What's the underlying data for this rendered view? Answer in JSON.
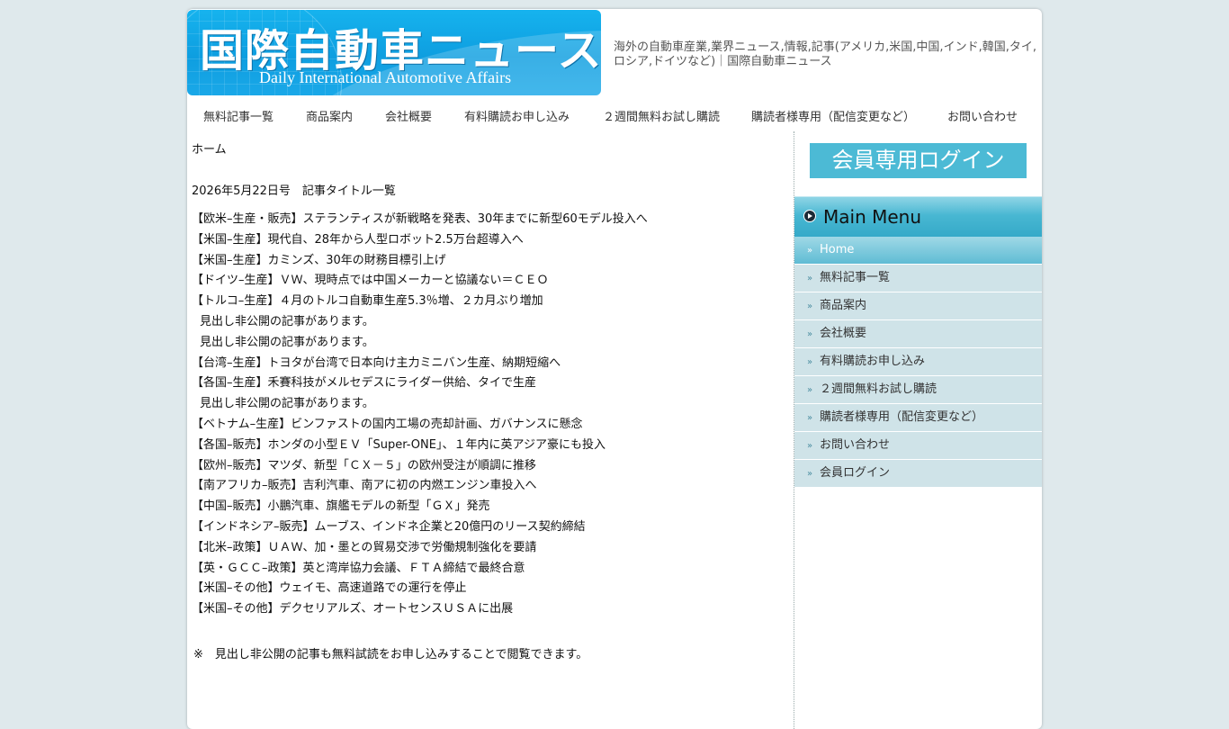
{
  "header": {
    "logo_title": "国際自動車ニュース",
    "logo_subtitle": "Daily International Automotive Affairs",
    "tagline": "海外の自動車産業,業界ニュース,情報,記事(アメリカ,米国,中国,インド,韓国,タイ,ロシア,ドイツなど)｜国際自動車ニュース"
  },
  "topnav": [
    "無料記事一覧",
    "商品案内",
    "会社概要",
    "有料購読お申し込み",
    "２週間無料お試し購読",
    "購読者様専用（配信変更など）",
    "お問い合わせ"
  ],
  "main": {
    "breadcrumb": "ホーム",
    "issue_heading": "2026年5月22日号　記事タイトル一覧",
    "articles": [
      "【欧米–生産・販売】ステランティスが新戦略を発表、30年までに新型60モデル投入へ",
      "【米国–生産】現代自、28年から人型ロボット2.5万台超導入へ",
      "【米国–生産】カミンズ、30年の財務目標引上げ",
      "【ドイツ–生産】ＶＷ、現時点では中国メーカーと協議ない＝ＣＥＯ",
      "【トルコ–生産】４月のトルコ自動車生産5.3％増、２カ月ぶり増加",
      "見出し非公開の記事があります。",
      "見出し非公開の記事があります。",
      "【台湾–生産】トヨタが台湾で日本向け主力ミニバン生産、納期短縮へ",
      "【各国–生産】禾賽科技がメルセデスにライダー供給、タイで生産",
      "見出し非公開の記事があります。",
      "【ベトナム–生産】ビンファストの国内工場の売却計画、ガバナンスに懸念",
      "【各国–販売】ホンダの小型ＥＶ「Super-ONE」、１年内に英アジア豪にも投入",
      "【欧州–販売】マツダ、新型「ＣＸ－５」の欧州受注が順調に推移",
      "【南アフリカ–販売】吉利汽車、南アに初の内燃エンジン車投入へ",
      "【中国–販売】小鵬汽車、旗艦モデルの新型「ＧＸ」発売",
      "【インドネシア–販売】ムーブス、インドネ企業と20億円のリース契約締結",
      "【北米–政策】ＵＡＷ、加・墨との貿易交渉で労働規制強化を要請",
      "【英・ＧＣＣ–政策】英と湾岸協力会議、ＦＴＡ締結で最終合意",
      "【米国–その他】ウェイモ、高速道路での運行を停止",
      "【米国–その他】デクセリアルズ、オートセンスＵＳＡに出展"
    ],
    "footnote": "※　見出し非公開の記事も無料試読をお申し込みすることで閲覧できます。"
  },
  "sidebar": {
    "login_button": "会員専用ログイン",
    "menu_title": "Main Menu",
    "menu_items": [
      "Home",
      "無料記事一覧",
      "商品案内",
      "会社概要",
      "有料購読お申し込み",
      "２週間無料お試し購読",
      "購読者様専用（配信変更など）",
      "お問い合わせ",
      "会員ログイン"
    ],
    "active_index": 0
  },
  "colors": {
    "page_bg": "#dfe9ec",
    "logo_blue": "#0e9ee0",
    "login_button": "#4cbad5",
    "menu_header": "#48b7d2",
    "menu_item_bg": "#cfe3e8"
  },
  "icons": {
    "menu_header": "play-circle-icon",
    "menu_item": "double-chevron-right-icon"
  }
}
